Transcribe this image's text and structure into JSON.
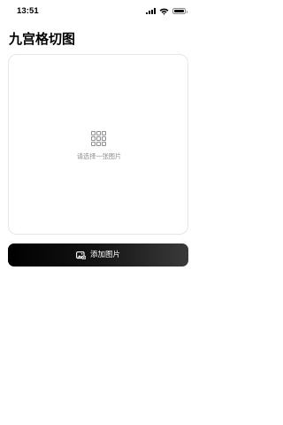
{
  "status_bar": {
    "time": "13:51"
  },
  "page": {
    "title": "九宫格切图"
  },
  "image_card": {
    "icon": "grid-3x3-icon",
    "placeholder_text": "请选择一张图片"
  },
  "add_button": {
    "icon": "photo-add-icon",
    "label": "添加图片"
  },
  "colors": {
    "background": "#ffffff",
    "button": "#000000",
    "button_text": "#ffffff",
    "placeholder": "#8e8e93",
    "card_border": "#e6e6e6"
  }
}
